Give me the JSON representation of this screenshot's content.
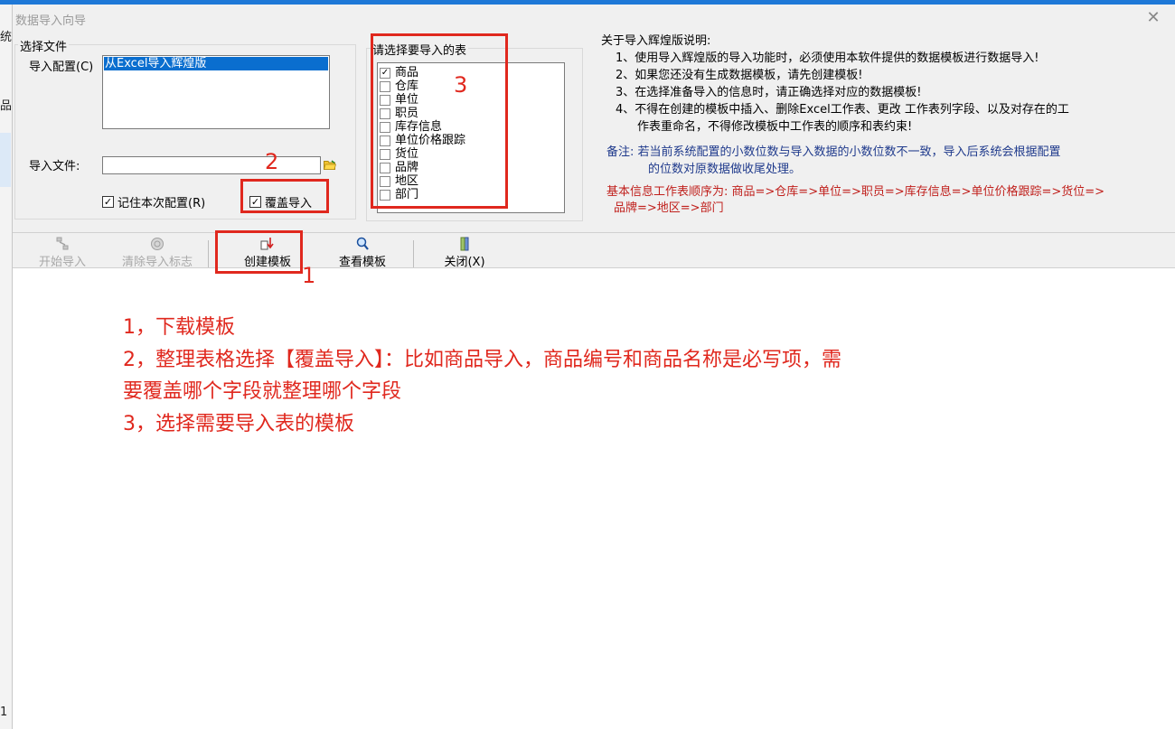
{
  "window": {
    "title": "数据导入向导",
    "close_glyph": "✕"
  },
  "background_fragments": [
    "统",
    "品",
    "1"
  ],
  "select_file": {
    "legend": "选择文件",
    "config_label": "导入配置(C)",
    "config_selected": "从Excel导入辉煌版",
    "file_label": "导入文件:",
    "file_value": "",
    "remember_label": "记住本次配置(R)",
    "remember_checked": true,
    "overwrite_label": "覆盖导入",
    "overwrite_checked": true
  },
  "tables": {
    "legend": "请选择要导入的表",
    "items": [
      {
        "label": "商品",
        "checked": true
      },
      {
        "label": "仓库",
        "checked": false
      },
      {
        "label": "单位",
        "checked": false
      },
      {
        "label": "职员",
        "checked": false
      },
      {
        "label": "库存信息",
        "checked": false
      },
      {
        "label": "单位价格跟踪",
        "checked": false
      },
      {
        "label": "货位",
        "checked": false
      },
      {
        "label": "品牌",
        "checked": false
      },
      {
        "label": "地区",
        "checked": false
      },
      {
        "label": "部门",
        "checked": false
      }
    ]
  },
  "instructions": {
    "heading": "关于导入辉煌版说明:",
    "lines": [
      "1、使用导入辉煌版的导入功能时，必须使用本软件提供的数据模板进行数据导入!",
      "2、如果您还没有生成数据模板，请先创建模板!",
      "3、在选择准备导入的信息时，请正确选择对应的数据模板!",
      "4、不得在创建的模板中插入、删除Excel工作表、更改 工作表列字段、以及对存在的工",
      "作表重命名，不得修改模板中工作表的顺序和表约束!"
    ],
    "remark_1": "备注: 若当前系统配置的小数位数与导入数据的小数位数不一致，导入后系统会根据配置",
    "remark_2": "的位数对原数据做收尾处理。",
    "order_1": "基本信息工作表顺序为: 商品=>仓库=>单位=>职员=>库存信息=>单位价格跟踪=>货位=>",
    "order_2": "品牌=>地区=>部门"
  },
  "toolbar": {
    "start_import": "开始导入",
    "clear_flag": "清除导入标志",
    "create_template": "创建模板",
    "view_template": "查看模板",
    "close": "关闭(X)"
  },
  "annotations": {
    "marker_1": "1",
    "marker_2": "2",
    "marker_3": "3",
    "notes": [
      "1，下载模板",
      "2，整理表格选择【覆盖导入】：比如商品导入，商品编号和商品名称是必写项，需",
      "要覆盖哪个字段就整理哪个字段",
      "3，选择需要导入表的模板"
    ]
  },
  "colors": {
    "title_bar_accent": "#1e78d7",
    "annotation_red": "#e0281e",
    "selection_blue": "#0a6ecf",
    "remark_navy": "#1f3a8c",
    "order_maroon": "#c0201c"
  }
}
